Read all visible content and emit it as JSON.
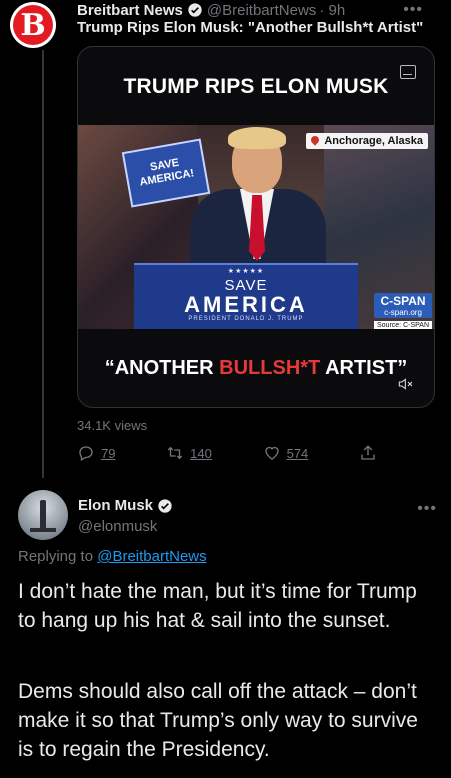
{
  "tweet1": {
    "avatar_letter": "B",
    "display_name": "Breitbart News",
    "handle": "@BreitbartNews",
    "time": "· 9h",
    "text": "Trump Rips Elon Musk:  \"Another Bullsh*t Artist\"",
    "media": {
      "title": "TRUMP RIPS ELON MUSK",
      "sign_text": "SAVE AMERICA!",
      "location": "Anchorage, Alaska",
      "podium_stars": "★★★★★",
      "podium_line1": "SAVE",
      "podium_line2": "AMERICA",
      "podium_line3": "PRESIDENT DONALD J. TRUMP",
      "cspan_logo": "C-SPAN",
      "cspan_url": "c-span.org",
      "cspan_source": "Source: C-SPAN",
      "quote_white_open": "“ANOTHER ",
      "quote_red": "BULLSH*T",
      "quote_white_close": " ARTIST”"
    },
    "views": "34.1K views",
    "replies": "79",
    "retweets": "140",
    "likes": "574"
  },
  "tweet2": {
    "display_name": "Elon Musk",
    "handle": "@elonmusk",
    "replying_prefix": "Replying to ",
    "replying_to": "@BreitbartNews",
    "paragraph1": "I don’t hate the man, but it’s time for Trump to hang up his hat & sail into the sunset.",
    "paragraph2": "Dems should also call off the attack – don’t make it so that Trump’s only way to survive is to regain the Presidency."
  },
  "icons": {
    "verified": "verified-badge-icon",
    "more": "more-options-icon",
    "reply": "reply-icon",
    "retweet": "retweet-icon",
    "like": "heart-icon",
    "share": "share-icon",
    "captions": "closed-captions-icon",
    "mute": "mute-icon"
  },
  "colors": {
    "accent": "#1d9bf0",
    "background": "#000000",
    "text": "#e7e9ea",
    "secondary": "#71767b",
    "quote_red": "#e53a3a"
  }
}
